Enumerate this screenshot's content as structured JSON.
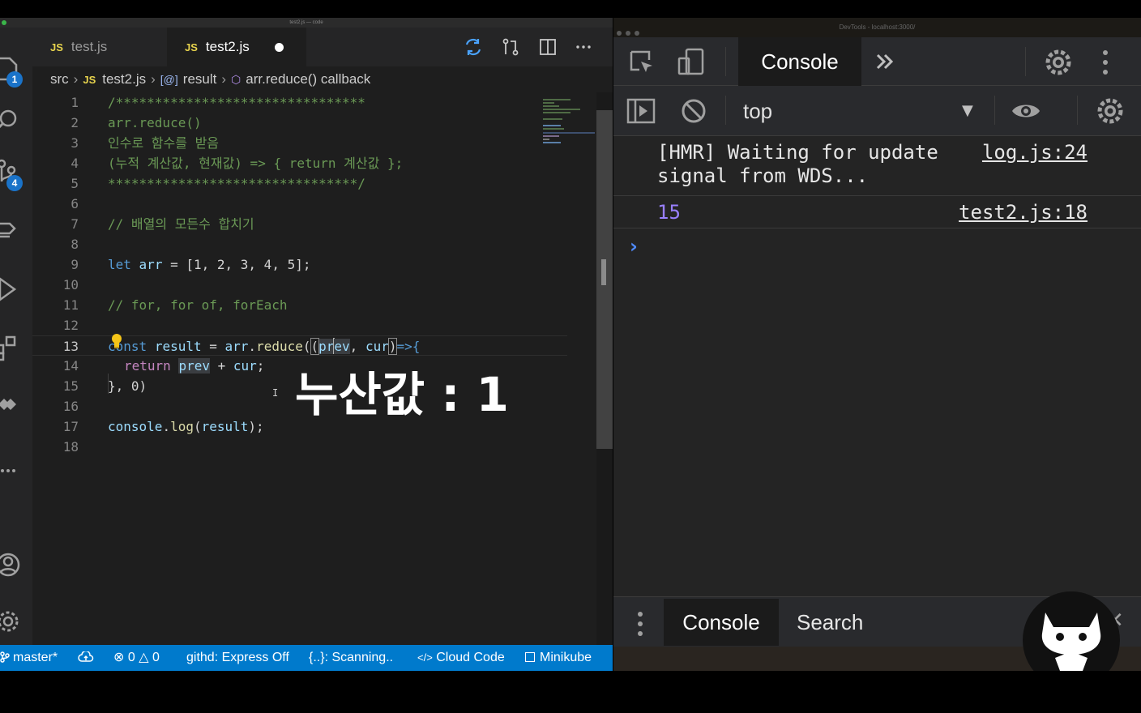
{
  "vscode": {
    "window_title": "test2.js — code",
    "activity": {
      "explorer_badge": "1",
      "scm_badge": "4"
    },
    "tabs": [
      {
        "label": "test.js",
        "icon": "JS",
        "active": false
      },
      {
        "label": "test2.js",
        "icon": "JS",
        "active": true,
        "dirty": true
      }
    ],
    "breadcrumb": {
      "folder": "src",
      "file_icon": "JS",
      "file": "test2.js",
      "symbol_icon": "[@]",
      "symbol": "result",
      "callback_icon": "cube",
      "callback": "arr.reduce() callback"
    },
    "code": {
      "line_numbers": [
        "1",
        "2",
        "3",
        "4",
        "5",
        "6",
        "7",
        "8",
        "9",
        "10",
        "11",
        "12",
        "13",
        "14",
        "15",
        "16",
        "17",
        "18"
      ],
      "l1": "/********************************",
      "l2": "arr.reduce()",
      "l3": "인수로 함수를 받음",
      "l4": "(누적 계산값, 현재값) => { return 계산값 };",
      "l5": "********************************/",
      "l7": "// 배열의 모든수 합치기",
      "l9_kw": "let",
      "l9_var": "arr",
      "l9_rest": " = [1, 2, 3, 4, 5];",
      "l11": "// for, for of, forEach",
      "l13_kw": "const",
      "l13_var": "result",
      "l13_eq": " = ",
      "l13_obj": "arr",
      "l13_dot": ".",
      "l13_fn": "reduce",
      "l13_open": "(",
      "l13_paren": "(",
      "l13_p1a": "pr",
      "l13_p1b": "ev",
      "l13_comma": ", ",
      "l13_p2": "cur",
      "l13_close": ")",
      "l13_arrow": "=>{",
      "l14_kw": "return",
      "l14_a": "prev",
      "l14_rest": " + ",
      "l14_b": "cur",
      "l14_semi": ";",
      "l15": "}, 0)",
      "l17_obj": "console",
      "l17_dot": ".",
      "l17_fn": "log",
      "l17_open": "(",
      "l17_arg": "result",
      "l17_close": ");"
    },
    "overlay_caption": "누산값 : 1",
    "statusbar": {
      "branch": "master*",
      "errors": "0",
      "warnings": "0",
      "githd": "githd: Express Off",
      "scanning": "{..}: Scanning..",
      "cloud_code": "Cloud Code",
      "minikube": "Minikube"
    }
  },
  "devtools": {
    "window_title": "DevTools - localhost:3000/",
    "main_tab": "Console",
    "context": "top",
    "logs": [
      {
        "message": "[HMR] Waiting for update\nsignal from WDS...",
        "source": "log.js:24"
      },
      {
        "message": "15",
        "source": "test2.js:18"
      }
    ],
    "drawer_tabs": [
      "Console",
      "Search"
    ]
  }
}
